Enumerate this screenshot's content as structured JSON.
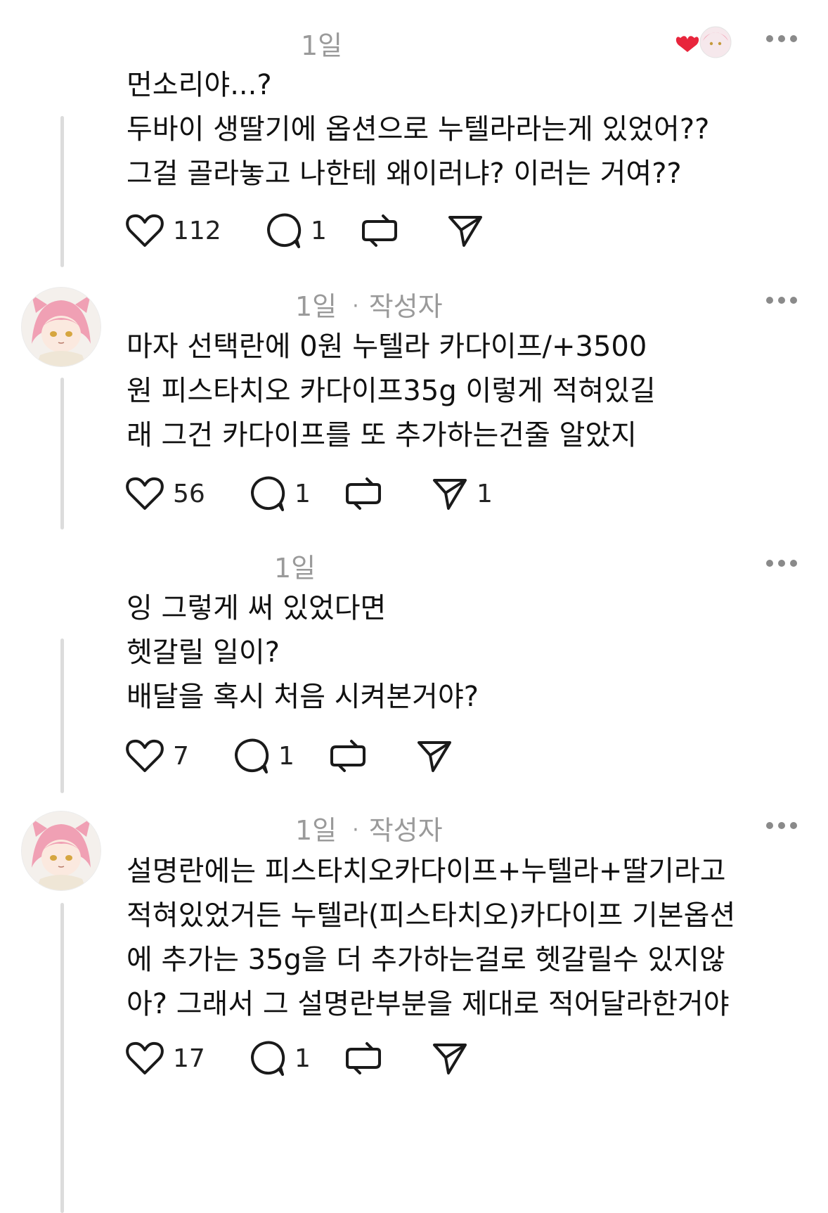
{
  "comments": [
    {
      "time": "1일",
      "is_author": false,
      "author_label": "",
      "lines": [
        "먼소리야...?",
        "두바이 생딸기에 옵션으로 누텔라라는게 있었어??",
        "그걸 골라놓고 나한테 왜이러냐? 이러는 거여??"
      ],
      "likes": "112",
      "replies": "1",
      "shares": ""
    },
    {
      "time": "1일",
      "is_author": true,
      "author_label": "작성자",
      "lines": [
        "마자 선택란에 0원 누텔라 카다이프/+3500",
        "원 피스타치오 카다이프35g 이렇게 적혀있길",
        "래 그건 카다이프를 또 추가하는건줄 알았지"
      ],
      "likes": "56",
      "replies": "1",
      "shares": "1"
    },
    {
      "time": "1일",
      "is_author": false,
      "author_label": "",
      "lines": [
        "잉 그렇게 써 있었다면",
        "헷갈릴 일이?",
        "배달을 혹시 처음 시켜본거야?"
      ],
      "likes": "7",
      "replies": "1",
      "shares": ""
    },
    {
      "time": "1일",
      "is_author": true,
      "author_label": "작성자",
      "lines": [
        "설명란에는 피스타치오카다이프+누텔라+딸기라고",
        "적혀있었거든 누텔라(피스타치오)카다이프 기본옵션",
        "에 추가는 35g을 더 추가하는걸로 헷갈릴수 있지않",
        "아? 그래서 그 설명란부분을 제대로 적어달라한거야"
      ],
      "likes": "17",
      "replies": "1",
      "shares": ""
    }
  ],
  "colors": {
    "heart_liked": "#e8253c",
    "meta_gray": "#9a9a9a",
    "thread_line": "#dcdcdc",
    "icon_stroke": "#1a1a1a"
  },
  "icons": {
    "like": "heart-icon",
    "reply": "speech-bubble-icon",
    "repost": "repost-arrows-icon",
    "share": "send-plane-icon",
    "more": "ellipsis-icon"
  }
}
